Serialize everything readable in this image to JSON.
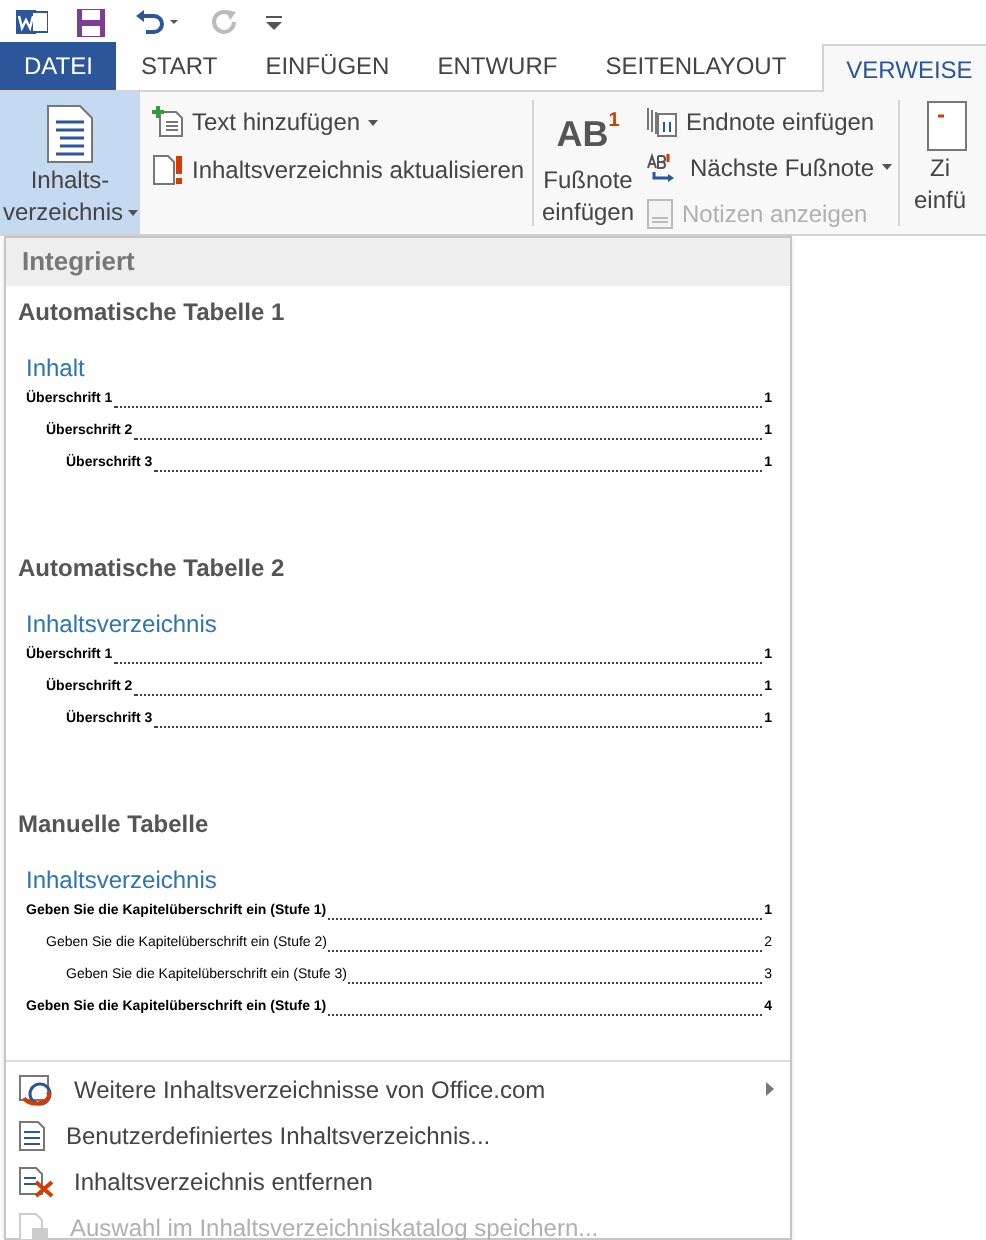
{
  "tabs": [
    {
      "label": "DATEI",
      "kind": "file",
      "selected": false
    },
    {
      "label": "START",
      "kind": "tab",
      "selected": false
    },
    {
      "label": "EINFÜGEN",
      "kind": "tab",
      "selected": false
    },
    {
      "label": "ENTWURF",
      "kind": "tab",
      "selected": false
    },
    {
      "label": "SEITENLAYOUT",
      "kind": "tab",
      "selected": false
    },
    {
      "label": "VERWEISE",
      "kind": "tab",
      "selected": true
    }
  ],
  "ribbon": {
    "toc_button": {
      "label_lines": [
        "Inhalts-",
        "verzeichnis"
      ],
      "selected": true
    },
    "toc_small": [
      {
        "label": "Text hinzufügen",
        "caret": true,
        "disabled": false
      },
      {
        "label": "Inhaltsverzeichnis aktualisieren",
        "caret": false,
        "disabled": false
      }
    ],
    "footnote_button": {
      "icon_text": "AB",
      "icon_sup": "1",
      "label_lines": [
        "Fußnote",
        "einfügen"
      ]
    },
    "footnote_small": [
      {
        "label": "Endnote einfügen",
        "caret": false,
        "disabled": false
      },
      {
        "label": "Nächste Fußnote",
        "caret": true,
        "disabled": false
      },
      {
        "label": "Notizen anzeigen",
        "caret": false,
        "disabled": true
      }
    ],
    "cut_button": {
      "label_lines": [
        "Zi",
        "einfü"
      ]
    }
  },
  "gallery": {
    "header": "Integriert",
    "sections": [
      {
        "title": "Automatische Tabelle 1",
        "heading": "Inhalt",
        "entries": [
          {
            "text": "Überschrift 1",
            "page": "1",
            "bold": true,
            "children": [
              {
                "text": "Überschrift 2",
                "page": "1",
                "bold": true,
                "children": [
                  {
                    "text": "Überschrift 3",
                    "page": "1",
                    "bold": true
                  }
                ]
              }
            ]
          }
        ]
      },
      {
        "title": "Automatische Tabelle 2",
        "heading": "Inhaltsverzeichnis",
        "entries": [
          {
            "text": "Überschrift 1",
            "page": "1",
            "bold": true,
            "children": [
              {
                "text": "Überschrift 2",
                "page": "1",
                "bold": true,
                "children": [
                  {
                    "text": "Überschrift 3",
                    "page": "1",
                    "bold": true
                  }
                ]
              }
            ]
          }
        ]
      },
      {
        "title": "Manuelle Tabelle",
        "heading": "Inhaltsverzeichnis",
        "entries": [
          {
            "text": "Geben Sie die Kapitelüberschrift ein (Stufe 1)",
            "page": "1",
            "bold": true,
            "children": [
              {
                "text": "Geben Sie die Kapitelüberschrift ein (Stufe 2)",
                "page": "2",
                "bold": false,
                "children": [
                  {
                    "text": "Geben Sie die Kapitelüberschrift ein (Stufe 3)",
                    "page": "3",
                    "bold": false
                  }
                ]
              }
            ]
          },
          {
            "text": "Geben Sie die Kapitelüberschrift ein (Stufe 1)",
            "page": "4",
            "bold": true
          }
        ]
      }
    ]
  },
  "menu": [
    {
      "label": "Weitere Inhaltsverzeichnisse von Office.com",
      "kind": "online",
      "submenu": true,
      "disabled": false
    },
    {
      "label": "Benutzerdefiniertes Inhaltsverzeichnis...",
      "kind": "custom",
      "submenu": false,
      "disabled": false
    },
    {
      "label": "Inhaltsverzeichnis entfernen",
      "kind": "remove",
      "submenu": false,
      "disabled": false
    },
    {
      "label": "Auswahl im Inhaltsverzeichniskatalog speichern...",
      "kind": "save",
      "submenu": false,
      "disabled": true
    }
  ]
}
